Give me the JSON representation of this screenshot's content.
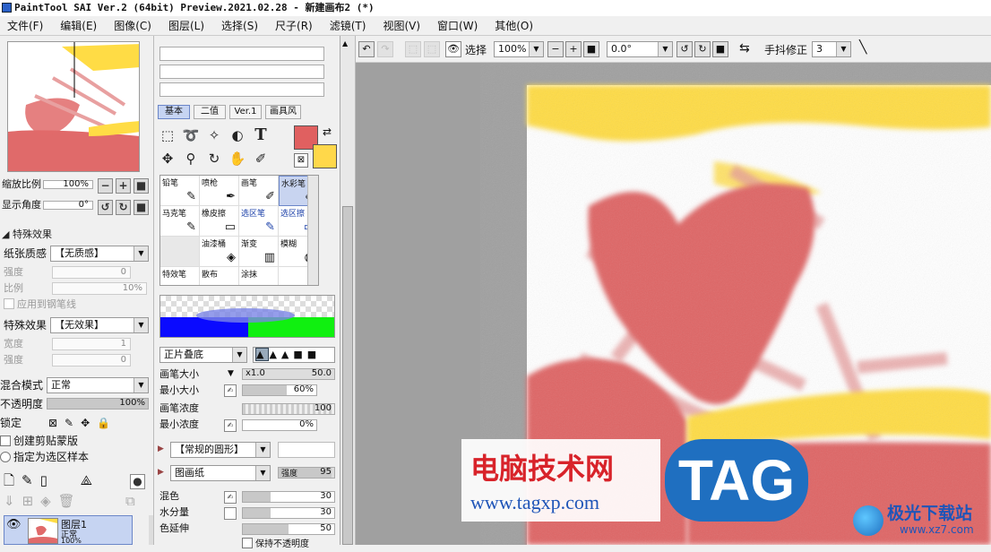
{
  "window": {
    "title": "PaintTool SAI Ver.2 (64bit) Preview.2021.02.28 - 新建画布2 (*)"
  },
  "menu": [
    "文件(F)",
    "编辑(E)",
    "图像(C)",
    "图层(L)",
    "选择(S)",
    "尺子(R)",
    "滤镜(T)",
    "视图(V)",
    "窗口(W)",
    "其他(O)"
  ],
  "navigator": {
    "zoom_label": "缩放比例",
    "zoom_value": "100%",
    "angle_label": "显示角度",
    "angle_value": "0°"
  },
  "effects": {
    "section_title": "特殊效果",
    "paper_label": "纸张质感",
    "paper_value": "【无质感】",
    "strength_label": "强度",
    "strength_value": "0",
    "ratio_label": "比例",
    "ratio_value": "10%",
    "apply_pen": "应用到钢笔线",
    "effect_label": "特殊效果",
    "effect_value": "【无效果】",
    "width_label": "宽度",
    "width_value": "1",
    "strength2_label": "强度",
    "strength2_value": "0"
  },
  "layer": {
    "blend_label": "混合模式",
    "blend_value": "正常",
    "opacity_label": "不透明度",
    "opacity_value": "100%",
    "lock_label": "锁定",
    "clip_label": "创建剪贴蒙版",
    "sample_label": "指定为选区样本",
    "name": "图层1",
    "mode": "正常",
    "opacity": "100%"
  },
  "tool_tabs": [
    "基本",
    "二值",
    "Ver.1",
    "画具风"
  ],
  "colors": {
    "primary": "#e06060",
    "secondary": "#ffd84a"
  },
  "brushes": [
    {
      "name": "铅笔",
      "icon": "✎"
    },
    {
      "name": "喷枪",
      "icon": "✒"
    },
    {
      "name": "画笔",
      "icon": "🖌"
    },
    {
      "name": "水彩笔",
      "icon": "🖌"
    },
    {
      "name": "马克笔",
      "icon": "✎"
    },
    {
      "name": "橡皮擦",
      "icon": "▭"
    },
    {
      "name": "选区笔",
      "icon": "✎"
    },
    {
      "name": "选区擦",
      "icon": "▭"
    },
    {
      "name": "",
      "icon": ""
    },
    {
      "name": "油漆桶",
      "icon": "◈"
    },
    {
      "name": "渐变",
      "icon": "▥"
    },
    {
      "name": "模糊",
      "icon": "💧"
    },
    {
      "name": "特效笔",
      "icon": ""
    },
    {
      "name": "散布",
      "icon": ""
    },
    {
      "name": "涂抹",
      "icon": ""
    },
    {
      "name": "",
      "icon": ""
    }
  ],
  "brush_props": {
    "blend_mode": "正片叠底",
    "size_label": "画笔大小",
    "size_mult": "x1.0",
    "size_value": "50.0",
    "min_size_label": "最小大小",
    "min_size_value": "60%",
    "density_label": "画笔浓度",
    "density_value": "100",
    "min_density_label": "最小浓度",
    "min_density_value": "0%",
    "shape": "【常规的圆形】",
    "texture": "图画纸",
    "texture_strength_label": "强度",
    "texture_strength": "95",
    "mix_label": "混色",
    "mix_value": "30",
    "water_label": "水分量",
    "water_value": "30",
    "persist_label": "色延伸",
    "persist_value": "50",
    "keep_opacity": "保持不透明度"
  },
  "progress": {
    "min_size": 0.6,
    "density": 1.0,
    "min_density": 0.0,
    "mix": 0.3,
    "water": 0.3,
    "persist": 0.5,
    "texture": 0.95
  },
  "toolbar": {
    "select_label": "选择",
    "zoom": "100%",
    "angle": "0.0°",
    "stab_label": "手抖修正",
    "stab_value": "3"
  },
  "watermark": {
    "site_cn": "电脑技术网",
    "site_url": "www.tagxp.com",
    "badge": "TAG",
    "corner": "极光下载站",
    "corner_url": "www.xz7.com"
  }
}
